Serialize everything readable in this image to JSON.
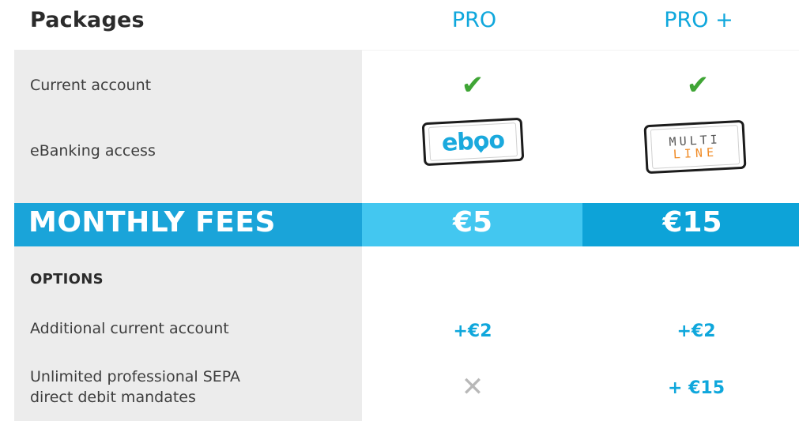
{
  "header": {
    "title": "Packages",
    "columns": [
      "PRO",
      "PRO +"
    ]
  },
  "rows": {
    "current_account": {
      "label": "Current account",
      "pro": "✔",
      "pro_plus": "✔"
    },
    "ebanking": {
      "label": "eBanking access",
      "pro_logo": "eboo",
      "pro_plus_logo_top": "MULTI",
      "pro_plus_logo_bottom": "LINE"
    }
  },
  "monthly_fees": {
    "label": "MONTHLY FEES",
    "pro": "€5",
    "pro_plus": "€15"
  },
  "options": {
    "title": "OPTIONS",
    "additional_account": {
      "label": "Additional current account",
      "pro": "+€2",
      "pro_plus": "+€2"
    },
    "sepa": {
      "label_line1": "Unlimited professional SEPA",
      "label_line2": "direct debit mandates",
      "pro": "✕",
      "pro_plus": "+ €15"
    }
  },
  "colors": {
    "accent": "#0fa7dc",
    "fees_left": "#1aa4d9",
    "fees_mid": "#43c7f0",
    "fees_right": "#0da3d8",
    "check": "#3fa535",
    "cross": "#b8b8b8",
    "panel": "#ececec",
    "multiline_orange": "#f08a24"
  },
  "icons": {
    "included": "check-icon",
    "not_included": "cross-icon",
    "ebanking_pro": "eboo-phone-logo",
    "ebanking_pro_plus": "multiline-phone-logo"
  }
}
